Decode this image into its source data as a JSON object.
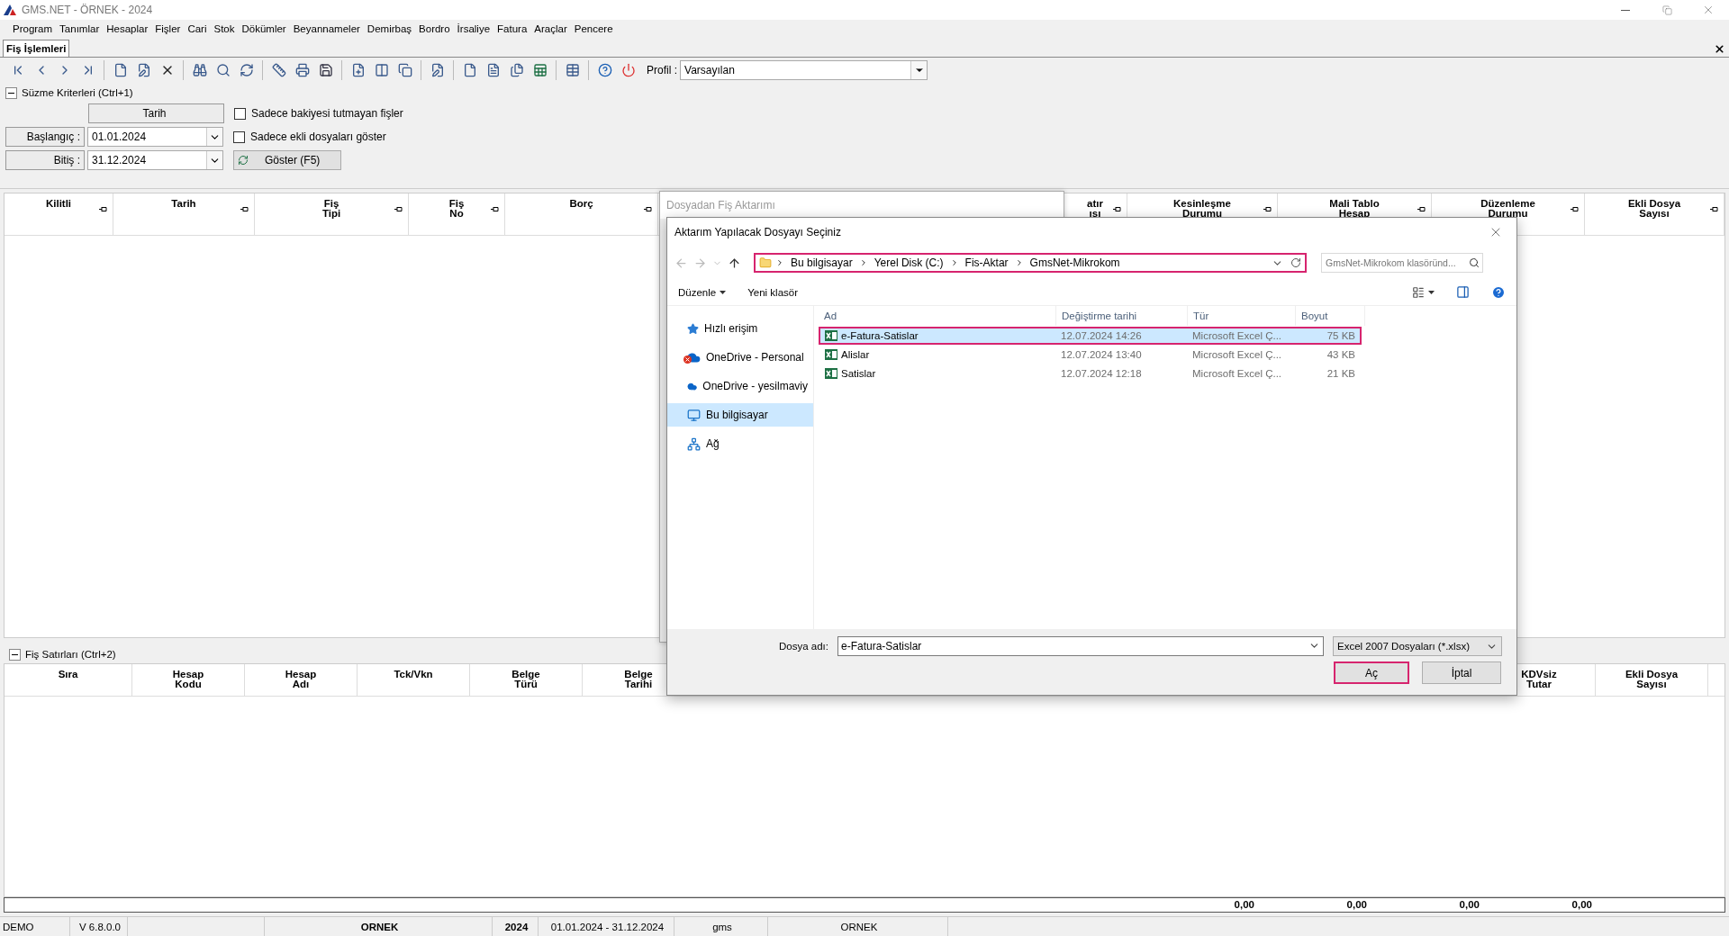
{
  "window": {
    "title": "GMS.NET - ÖRNEK - 2024"
  },
  "menu": [
    "Program",
    "Tanımlar",
    "Hesaplar",
    "Fişler",
    "Cari",
    "Stok",
    "Dökümler",
    "Beyannameler",
    "Demirbaş",
    "Bordro",
    "İrsaliye",
    "Fatura",
    "Araçlar",
    "Pencere"
  ],
  "document_tab": {
    "label": "Fiş İşlemleri",
    "selected": true
  },
  "toolbar": {
    "profile_label": "Profil :",
    "profile_value": "Varsayılan"
  },
  "filter": {
    "title": "Süzme Kriterleri (Ctrl+1)",
    "expanded": true,
    "date_header": "Tarih",
    "start_label": "Başlangıç :",
    "start_value": "01.01.2024",
    "end_label": "Bitiş :",
    "end_value": "31.12.2024",
    "show_button": "Göster (F5)",
    "checkboxes": [
      {
        "label": "Sadece bakiyesi tutmayan fişler",
        "checked": false
      },
      {
        "label": "Sadece ekli dosyaları göster",
        "checked": false
      }
    ]
  },
  "upper_grid": {
    "columns": [
      {
        "label": "Kilitli"
      },
      {
        "label": "Tarih"
      },
      {
        "label": "Fiş\nTipi"
      },
      {
        "label": "Fiş\nNo"
      },
      {
        "label": "Borç"
      },
      {
        "label": "atır\nısı"
      },
      {
        "label": "Kesinleşme\nDurumu"
      },
      {
        "label": "Mali Tablo\nHesap"
      },
      {
        "label": "Düzenleme\nDurumu"
      },
      {
        "label": "Ekli Dosya\nSayısı"
      }
    ]
  },
  "lower_section": {
    "title": "Fiş Satırları (Ctrl+2)",
    "expanded": true
  },
  "lower_grid": {
    "columns": [
      {
        "label": "Sıra"
      },
      {
        "label": "Hesap\nKodu"
      },
      {
        "label": "Hesap\nAdı"
      },
      {
        "label": "Tck/Vkn"
      },
      {
        "label": "Belge\nTürü"
      },
      {
        "label": "Belge\nTarihi"
      },
      {
        "label": "KDVsiz\nTutar"
      },
      {
        "label": "Ekli Dosya\nSayısı"
      }
    ],
    "totals": [
      "0,00",
      "0,00",
      "0,00",
      "0,00"
    ]
  },
  "status_bar": [
    {
      "text": "DEMO",
      "bold": false
    },
    {
      "text": "V 6.8.0.0",
      "bold": false
    },
    {
      "text": "ORNEK",
      "bold": true
    },
    {
      "text": "2024",
      "bold": true
    },
    {
      "text": "01.01.2024 - 31.12.2024",
      "bold": false
    },
    {
      "text": "gms",
      "bold": false
    },
    {
      "text": "ORNEK",
      "bold": false
    }
  ],
  "back_dialog": {
    "title": "Dosyadan Fiş Aktarımı"
  },
  "file_dialog": {
    "title": "Aktarım Yapılacak Dosyayı Seçiniz",
    "path": [
      "Bu bilgisayar",
      "Yerel Disk (C:)",
      "Fis-Aktar",
      "GmsNet-Mikrokom"
    ],
    "path_highlighted": true,
    "search_placeholder": "GmsNet-Mikrokom klasöründ...",
    "organize": "Düzenle",
    "new_folder": "Yeni klasör",
    "nav": [
      {
        "label": "Hızlı erişim",
        "kind": "star",
        "selected": false
      },
      {
        "label": "OneDrive - Personal",
        "kind": "cloud-error",
        "selected": false
      },
      {
        "label": "OneDrive - yesilmaviy",
        "kind": "cloud",
        "selected": false
      },
      {
        "label": "Bu bilgisayar",
        "kind": "pc",
        "selected": true
      },
      {
        "label": "Ağ",
        "kind": "network",
        "selected": false
      }
    ],
    "columns": [
      "Ad",
      "Değiştirme tarihi",
      "Tür",
      "Boyut"
    ],
    "files": [
      {
        "name": "e-Fatura-Satislar",
        "date": "12.07.2024 14:26",
        "type": "Microsoft Excel Ç...",
        "size": "75 KB",
        "selected": true,
        "highlighted": true
      },
      {
        "name": "Alislar",
        "date": "12.07.2024 13:40",
        "type": "Microsoft Excel Ç...",
        "size": "43 KB",
        "selected": false,
        "highlighted": false
      },
      {
        "name": "Satislar",
        "date": "12.07.2024 12:18",
        "type": "Microsoft Excel Ç...",
        "size": "21 KB",
        "selected": false,
        "highlighted": false
      }
    ],
    "filename_label": "Dosya adı:",
    "filename_value": "e-Fatura-Satislar",
    "filetype": "Excel 2007 Dosyaları (*.xlsx)",
    "open_button": {
      "label": "Aç",
      "highlighted": true
    },
    "cancel_button": "İptal"
  }
}
